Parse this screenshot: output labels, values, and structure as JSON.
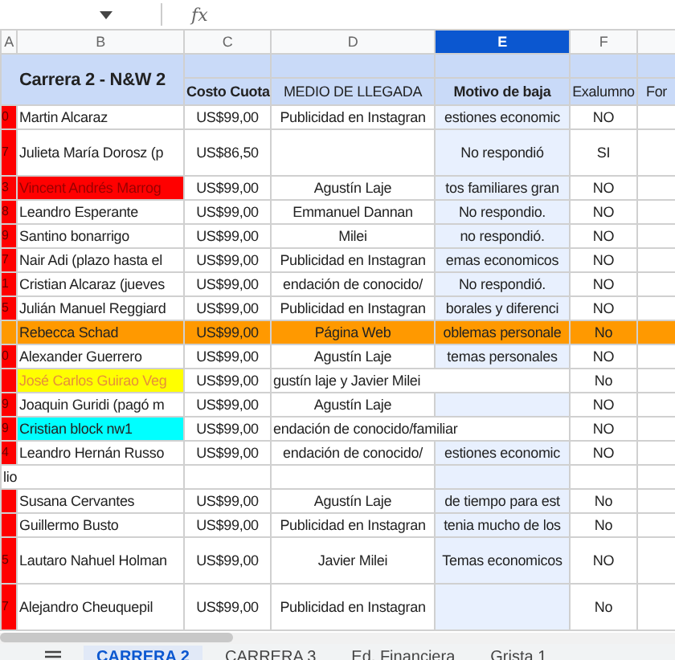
{
  "formula_bar": {
    "fx_label": "fx"
  },
  "columns": [
    {
      "letter": "A",
      "selected": false
    },
    {
      "letter": "B",
      "selected": false
    },
    {
      "letter": "C",
      "selected": false
    },
    {
      "letter": "D",
      "selected": false
    },
    {
      "letter": "E",
      "selected": true
    },
    {
      "letter": "F",
      "selected": false
    },
    {
      "selected": false
    }
  ],
  "sheet_title": "Carrera 2 - N&W 2",
  "headers": [
    {
      "text": "Costo Cuota",
      "bold": true
    },
    {
      "text": "MEDIO DE LLEGADA",
      "bold": false
    },
    {
      "text": "Motivo de baja",
      "bold": true
    },
    {
      "text": "Exalumno",
      "bold": false
    },
    {
      "text": "For",
      "bold": false
    }
  ],
  "rows": [
    {
      "kind": "person",
      "tall": false,
      "row_highlighted": false,
      "color": "#ff0000",
      "id": "0",
      "name": {
        "text": "Martin Alcaraz"
      },
      "cost": "US$99,00",
      "channel": "Publicidad en Instagran",
      "reason": "estiones economic",
      "exalumno": "NO"
    },
    {
      "kind": "person",
      "tall": true,
      "row_highlighted": false,
      "color": "#ff0000",
      "id": "7",
      "name": {
        "text": "Julieta María Dorosz (p"
      },
      "cost": "US$86,50",
      "channel": "",
      "reason": "No respondió",
      "exalumno": "SI"
    },
    {
      "kind": "person",
      "tall": false,
      "row_highlighted": false,
      "color": "#ff0000",
      "id": "3",
      "name": {
        "text": "Vincent Andrés Marrog",
        "color": "#ff0000"
      },
      "cost": "US$99,00",
      "channel": "Agustín Laje",
      "reason": "tos familiares gran",
      "exalumno": "NO"
    },
    {
      "kind": "person",
      "tall": false,
      "row_highlighted": false,
      "color": "#ff0000",
      "id": "8",
      "name": {
        "text": "Leandro Esperante"
      },
      "cost": "US$99,00",
      "channel": "Emmanuel Dannan",
      "reason": "No respondio.",
      "exalumno": "NO"
    },
    {
      "kind": "person",
      "tall": false,
      "row_highlighted": false,
      "color": "#ff0000",
      "id": "9",
      "name": {
        "text": "Santino bonarrigo"
      },
      "cost": "US$99,00",
      "channel": "Milei",
      "reason": "no respondió.",
      "exalumno": "NO"
    },
    {
      "kind": "person",
      "tall": false,
      "row_highlighted": false,
      "color": "#ff0000",
      "id": "7",
      "name": {
        "text": "Nair Adi (plazo hasta el"
      },
      "cost": "US$99,00",
      "channel": "Publicidad en Instagran",
      "reason": "emas economicos",
      "exalumno": "NO"
    },
    {
      "kind": "person",
      "tall": false,
      "row_highlighted": false,
      "color": "#ff0000",
      "id": "1",
      "name": {
        "text": "Cristian Alcaraz (jueves"
      },
      "cost": "US$99,00",
      "channel": "endación de conocido/",
      "reason": "No respondió.",
      "exalumno": "NO"
    },
    {
      "kind": "person",
      "tall": false,
      "row_highlighted": false,
      "color": "#ff0000",
      "id": "5",
      "name": {
        "text": "Julián Manuel Reggiard"
      },
      "cost": "US$99,00",
      "channel": "Publicidad en Instagran",
      "reason": "borales y diferenci",
      "exalumno": "NO"
    },
    {
      "kind": "person",
      "tall": false,
      "row_highlighted": true,
      "color": "#ff9900",
      "id": "",
      "name": {
        "text": "Rebecca Schad",
        "color": "#ff9900"
      },
      "cost": "US$99,00",
      "channel": "Página Web",
      "reason": "oblemas personale",
      "exalumno": "No"
    },
    {
      "kind": "person",
      "tall": false,
      "row_highlighted": false,
      "color": "#ff0000",
      "id": "0",
      "name": {
        "text": "Alexander Guerrero"
      },
      "cost": "US$99,00",
      "channel": "Agustín Laje",
      "reason": "temas personales",
      "exalumno": "NO"
    },
    {
      "kind": "spill",
      "tall": false,
      "row_highlighted": false,
      "color": "#ff0000",
      "id": "",
      "name": {
        "text": "José Carlos Guirao Veg",
        "color": "#ffff00"
      },
      "cost": "US$99,00",
      "channel": "gustín laje y Javier Milei",
      "exalumno": "No"
    },
    {
      "kind": "person",
      "tall": false,
      "row_highlighted": false,
      "color": "#ff0000",
      "id": "9",
      "name": {
        "text": "Joaquin Guridi (pagó m"
      },
      "cost": "US$99,00",
      "channel": "Agustín Laje",
      "reason": "",
      "exalumno": "NO"
    },
    {
      "kind": "spill",
      "tall": false,
      "row_highlighted": false,
      "color": "#ff0000",
      "id": "9",
      "name": {
        "text": "Cristian block nw1",
        "color": "#00ffff"
      },
      "cost": "US$99,00",
      "channel": "endación de conocido/familiar",
      "exalumno": "NO"
    },
    {
      "kind": "person",
      "tall": false,
      "row_highlighted": false,
      "color": "#ff0000",
      "id": "4",
      "name": {
        "text": "Leandro Hernán Russo"
      },
      "cost": "US$99,00",
      "channel": "endación de conocido/",
      "reason": "estiones economic",
      "exalumno": "NO"
    },
    {
      "kind": "group",
      "label": "lio"
    },
    {
      "kind": "person",
      "tall": false,
      "row_highlighted": false,
      "color": "#ff0000",
      "id": "",
      "name": {
        "text": "Susana Cervantes"
      },
      "cost": "US$99,00",
      "channel": "Agustín Laje",
      "reason": "de tiempo para est",
      "exalumno": "No"
    },
    {
      "kind": "person",
      "tall": false,
      "row_highlighted": false,
      "color": "#ff0000",
      "id": "",
      "name": {
        "text": "Guillermo Busto"
      },
      "cost": "US$99,00",
      "channel": "Publicidad en Instagran",
      "reason": "tenia mucho de los",
      "exalumno": "No"
    },
    {
      "kind": "person",
      "tall": true,
      "row_highlighted": false,
      "color": "#ff0000",
      "id": "5",
      "name": {
        "text": "Lautaro Nahuel Holman"
      },
      "cost": "US$99,00",
      "channel": "Javier Milei",
      "reason": "Temas economicos",
      "exalumno": "NO"
    },
    {
      "kind": "person",
      "tall": true,
      "row_highlighted": false,
      "color": "#ff0000",
      "id": "7",
      "name": {
        "text": "Alejandro Cheuquepil"
      },
      "cost": "US$99,00",
      "channel": "Publicidad en Instagran",
      "reason": "",
      "exalumno": "No"
    }
  ],
  "sheet_tabs": [
    {
      "label": "CARRERA 2",
      "selected": true
    },
    {
      "label": "CARRERA 3",
      "selected": false
    },
    {
      "label": "Ed. Financiera",
      "selected": false
    },
    {
      "label": "Grista 1",
      "selected": false
    }
  ]
}
